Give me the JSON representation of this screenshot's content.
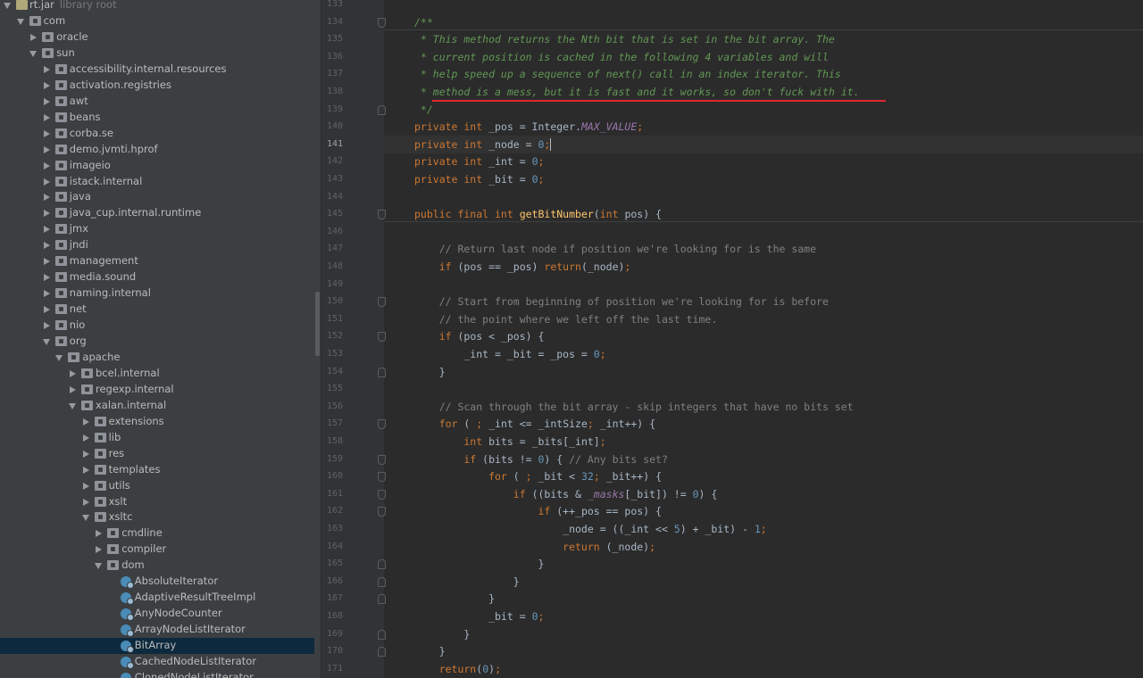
{
  "project_tree": {
    "root": {
      "label": "rt.jar",
      "sublabel": "library root"
    },
    "items": [
      {
        "label": "com",
        "depth": 1,
        "state": "open",
        "kind": "package"
      },
      {
        "label": "oracle",
        "depth": 2,
        "state": "closed",
        "kind": "package"
      },
      {
        "label": "sun",
        "depth": 2,
        "state": "open",
        "kind": "package"
      },
      {
        "label": "accessibility.internal.resources",
        "depth": 3,
        "state": "closed",
        "kind": "package"
      },
      {
        "label": "activation.registries",
        "depth": 3,
        "state": "closed",
        "kind": "package"
      },
      {
        "label": "awt",
        "depth": 3,
        "state": "closed",
        "kind": "package"
      },
      {
        "label": "beans",
        "depth": 3,
        "state": "closed",
        "kind": "package"
      },
      {
        "label": "corba.se",
        "depth": 3,
        "state": "closed",
        "kind": "package"
      },
      {
        "label": "demo.jvmti.hprof",
        "depth": 3,
        "state": "closed",
        "kind": "package"
      },
      {
        "label": "imageio",
        "depth": 3,
        "state": "closed",
        "kind": "package"
      },
      {
        "label": "istack.internal",
        "depth": 3,
        "state": "closed",
        "kind": "package"
      },
      {
        "label": "java",
        "depth": 3,
        "state": "closed",
        "kind": "package"
      },
      {
        "label": "java_cup.internal.runtime",
        "depth": 3,
        "state": "closed",
        "kind": "package"
      },
      {
        "label": "jmx",
        "depth": 3,
        "state": "closed",
        "kind": "package"
      },
      {
        "label": "jndi",
        "depth": 3,
        "state": "closed",
        "kind": "package"
      },
      {
        "label": "management",
        "depth": 3,
        "state": "closed",
        "kind": "package"
      },
      {
        "label": "media.sound",
        "depth": 3,
        "state": "closed",
        "kind": "package"
      },
      {
        "label": "naming.internal",
        "depth": 3,
        "state": "closed",
        "kind": "package"
      },
      {
        "label": "net",
        "depth": 3,
        "state": "closed",
        "kind": "package"
      },
      {
        "label": "nio",
        "depth": 3,
        "state": "closed",
        "kind": "package"
      },
      {
        "label": "org",
        "depth": 3,
        "state": "open",
        "kind": "package"
      },
      {
        "label": "apache",
        "depth": 4,
        "state": "open",
        "kind": "package"
      },
      {
        "label": "bcel.internal",
        "depth": 5,
        "state": "closed",
        "kind": "package"
      },
      {
        "label": "regexp.internal",
        "depth": 5,
        "state": "closed",
        "kind": "package"
      },
      {
        "label": "xalan.internal",
        "depth": 5,
        "state": "open",
        "kind": "package"
      },
      {
        "label": "extensions",
        "depth": 6,
        "state": "closed",
        "kind": "package"
      },
      {
        "label": "lib",
        "depth": 6,
        "state": "closed",
        "kind": "package"
      },
      {
        "label": "res",
        "depth": 6,
        "state": "closed",
        "kind": "package"
      },
      {
        "label": "templates",
        "depth": 6,
        "state": "closed",
        "kind": "package"
      },
      {
        "label": "utils",
        "depth": 6,
        "state": "closed",
        "kind": "package"
      },
      {
        "label": "xslt",
        "depth": 6,
        "state": "closed",
        "kind": "package"
      },
      {
        "label": "xsltc",
        "depth": 6,
        "state": "open",
        "kind": "package"
      },
      {
        "label": "cmdline",
        "depth": 7,
        "state": "closed",
        "kind": "package"
      },
      {
        "label": "compiler",
        "depth": 7,
        "state": "closed",
        "kind": "package"
      },
      {
        "label": "dom",
        "depth": 7,
        "state": "open",
        "kind": "package"
      },
      {
        "label": "AbsoluteIterator",
        "depth": 8,
        "state": "none",
        "kind": "class"
      },
      {
        "label": "AdaptiveResultTreeImpl",
        "depth": 8,
        "state": "none",
        "kind": "class"
      },
      {
        "label": "AnyNodeCounter",
        "depth": 8,
        "state": "none",
        "kind": "class"
      },
      {
        "label": "ArrayNodeListIterator",
        "depth": 8,
        "state": "none",
        "kind": "class"
      },
      {
        "label": "BitArray",
        "depth": 8,
        "state": "none",
        "kind": "class",
        "selected": true
      },
      {
        "label": "CachedNodeListIterator",
        "depth": 8,
        "state": "none",
        "kind": "class"
      },
      {
        "label": "ClonedNodeListIterator",
        "depth": 8,
        "state": "none",
        "kind": "class"
      }
    ]
  },
  "editor": {
    "current_line": 141,
    "lines": [
      {
        "n": 133,
        "t": []
      },
      {
        "n": 134,
        "t": [
          [
            "doc",
            "/**"
          ]
        ]
      },
      {
        "n": 135,
        "t": [
          [
            "doc",
            " * This method returns the Nth bit that is set in the bit array. The"
          ]
        ]
      },
      {
        "n": 136,
        "t": [
          [
            "doc",
            " * current position is cached in the following 4 variables and will"
          ]
        ]
      },
      {
        "n": 137,
        "t": [
          [
            "doc",
            " * help speed up a sequence of next() call in an index iterator. This"
          ]
        ]
      },
      {
        "n": 138,
        "t": [
          [
            "doc",
            " * method is a mess, but it is fast and it works, so don't fuck with it."
          ]
        ]
      },
      {
        "n": 139,
        "t": [
          [
            "doc",
            " */"
          ]
        ]
      },
      {
        "n": 140,
        "t": [
          [
            "kw",
            "private int "
          ],
          [
            "pn",
            "_pos = Integer."
          ],
          [
            "st",
            "MAX_VALUE"
          ],
          [
            "kw",
            ";"
          ]
        ]
      },
      {
        "n": 141,
        "t": [
          [
            "kw",
            "private int "
          ],
          [
            "pn",
            "_node = "
          ],
          [
            "num",
            "0"
          ],
          [
            "kw",
            ";"
          ]
        ]
      },
      {
        "n": 142,
        "t": [
          [
            "kw",
            "private int "
          ],
          [
            "pn",
            "_int = "
          ],
          [
            "num",
            "0"
          ],
          [
            "kw",
            ";"
          ]
        ]
      },
      {
        "n": 143,
        "t": [
          [
            "kw",
            "private int "
          ],
          [
            "pn",
            "_bit = "
          ],
          [
            "num",
            "0"
          ],
          [
            "kw",
            ";"
          ]
        ]
      },
      {
        "n": 144,
        "t": []
      },
      {
        "n": 145,
        "t": [
          [
            "kw",
            "public final int "
          ],
          [
            "fn",
            "getBitNumber"
          ],
          [
            "pn",
            "("
          ],
          [
            "kw",
            "int "
          ],
          [
            "pn",
            "pos) {"
          ]
        ]
      },
      {
        "n": 146,
        "t": []
      },
      {
        "n": 147,
        "t": [
          [
            "cm",
            "    // Return last node if position we're looking for is the same"
          ]
        ]
      },
      {
        "n": 148,
        "t": [
          [
            "kw",
            "    if "
          ],
          [
            "pn",
            "(pos == _pos) "
          ],
          [
            "kw",
            "return"
          ],
          [
            "pn",
            "(_node)"
          ],
          [
            "kw",
            ";"
          ]
        ]
      },
      {
        "n": 149,
        "t": []
      },
      {
        "n": 150,
        "t": [
          [
            "cm",
            "    // Start from beginning of position we're looking for is before"
          ]
        ]
      },
      {
        "n": 151,
        "t": [
          [
            "cm",
            "    // the point where we left off the last time."
          ]
        ]
      },
      {
        "n": 152,
        "t": [
          [
            "kw",
            "    if "
          ],
          [
            "pn",
            "(pos < _pos) {"
          ]
        ]
      },
      {
        "n": 153,
        "t": [
          [
            "pn",
            "        _int = _bit = _pos = "
          ],
          [
            "num",
            "0"
          ],
          [
            "kw",
            ";"
          ]
        ]
      },
      {
        "n": 154,
        "t": [
          [
            "pn",
            "    }"
          ]
        ]
      },
      {
        "n": 155,
        "t": []
      },
      {
        "n": 156,
        "t": [
          [
            "cm",
            "    // Scan through the bit array - skip integers that have no bits set"
          ]
        ]
      },
      {
        "n": 157,
        "t": [
          [
            "kw",
            "    for "
          ],
          [
            "pn",
            "( "
          ],
          [
            "kw",
            "; "
          ],
          [
            "pn",
            "_int <= _intSize"
          ],
          [
            "kw",
            "; "
          ],
          [
            "pn",
            "_int++) {"
          ]
        ]
      },
      {
        "n": 158,
        "t": [
          [
            "kw",
            "        int "
          ],
          [
            "pn",
            "bits = _bits[_int]"
          ],
          [
            "kw",
            ";"
          ]
        ]
      },
      {
        "n": 159,
        "t": [
          [
            "kw",
            "        if "
          ],
          [
            "pn",
            "(bits != "
          ],
          [
            "num",
            "0"
          ],
          [
            "pn",
            ") { "
          ],
          [
            "cm",
            "// Any bits set?"
          ]
        ]
      },
      {
        "n": 160,
        "t": [
          [
            "kw",
            "            for "
          ],
          [
            "pn",
            "( "
          ],
          [
            "kw",
            "; "
          ],
          [
            "pn",
            "_bit < "
          ],
          [
            "num",
            "32"
          ],
          [
            "kw",
            "; "
          ],
          [
            "pn",
            "_bit++) {"
          ]
        ]
      },
      {
        "n": 161,
        "t": [
          [
            "kw",
            "                if "
          ],
          [
            "pn",
            "((bits & "
          ],
          [
            "st",
            "_masks"
          ],
          [
            "pn",
            "[_bit]) != "
          ],
          [
            "num",
            "0"
          ],
          [
            "pn",
            ") {"
          ]
        ]
      },
      {
        "n": 162,
        "t": [
          [
            "kw",
            "                    if "
          ],
          [
            "pn",
            "(++_pos == pos) {"
          ]
        ]
      },
      {
        "n": 163,
        "t": [
          [
            "pn",
            "                        _node = ((_int << "
          ],
          [
            "num",
            "5"
          ],
          [
            "pn",
            ") + _bit) - "
          ],
          [
            "num",
            "1"
          ],
          [
            "kw",
            ";"
          ]
        ]
      },
      {
        "n": 164,
        "t": [
          [
            "kw",
            "                        return "
          ],
          [
            "pn",
            "(_node)"
          ],
          [
            "kw",
            ";"
          ]
        ]
      },
      {
        "n": 165,
        "t": [
          [
            "pn",
            "                    }"
          ]
        ]
      },
      {
        "n": 166,
        "t": [
          [
            "pn",
            "                }"
          ]
        ]
      },
      {
        "n": 167,
        "t": [
          [
            "pn",
            "            }"
          ]
        ]
      },
      {
        "n": 168,
        "t": [
          [
            "pn",
            "            _bit = "
          ],
          [
            "num",
            "0"
          ],
          [
            "kw",
            ";"
          ]
        ]
      },
      {
        "n": 169,
        "t": [
          [
            "pn",
            "        }"
          ]
        ]
      },
      {
        "n": 170,
        "t": [
          [
            "pn",
            "    }"
          ]
        ]
      },
      {
        "n": 171,
        "t": [
          [
            "kw",
            "    return"
          ],
          [
            "pn",
            "("
          ],
          [
            "num",
            "0"
          ],
          [
            "pn",
            ")"
          ],
          [
            "kw",
            ";"
          ]
        ]
      }
    ]
  },
  "colors": {
    "annotation_underline": "#e0282e",
    "selection": "#0d293e"
  }
}
